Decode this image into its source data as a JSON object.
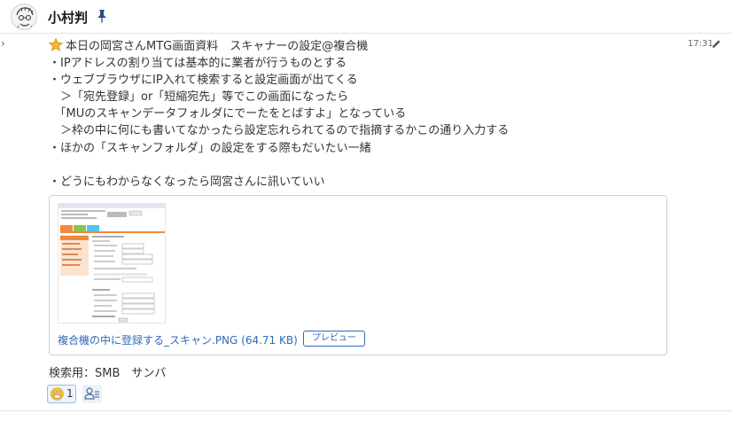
{
  "header": {
    "title": "小村判",
    "avatar_icon": "doodle-face-avatar",
    "pin_icon": "pin-icon"
  },
  "message": {
    "time": "17:31",
    "lines": [
      "本日の岡宮さんMTG画面資料　スキャナーの設定@複合機",
      "・IPアドレスの割り当ては基本的に業者が行うものとする",
      "・ウェブブラウザにIP入れて検索すると設定画面が出てくる",
      "　＞「宛先登録」or「短縮宛先」等でこの画面になったら",
      "　「MUのスキャンデータフォルダにでーたをとばすよ」となっている",
      "　＞枠の中に何にも書いてなかったら設定忘れられてるので指摘するかこの通り入力する",
      "・ほかの「スキャンフォルダ」の設定をする際もだいたい一緒",
      "",
      "・どうにもわからなくなったら岡宮さんに訊いていい"
    ],
    "attachment": {
      "file_name": "複合機の中に登録する_スキャン.PNG (64.71 KB)",
      "preview_label": "プレビュー"
    },
    "search_note": "検索用：SMB　サンバ",
    "reaction": {
      "emoji": "grinning-face-emoji",
      "count": "1"
    }
  },
  "colors": {
    "link": "#2e6bb5",
    "star": "#f5a623",
    "thumb_accent": "#f08a3c"
  }
}
